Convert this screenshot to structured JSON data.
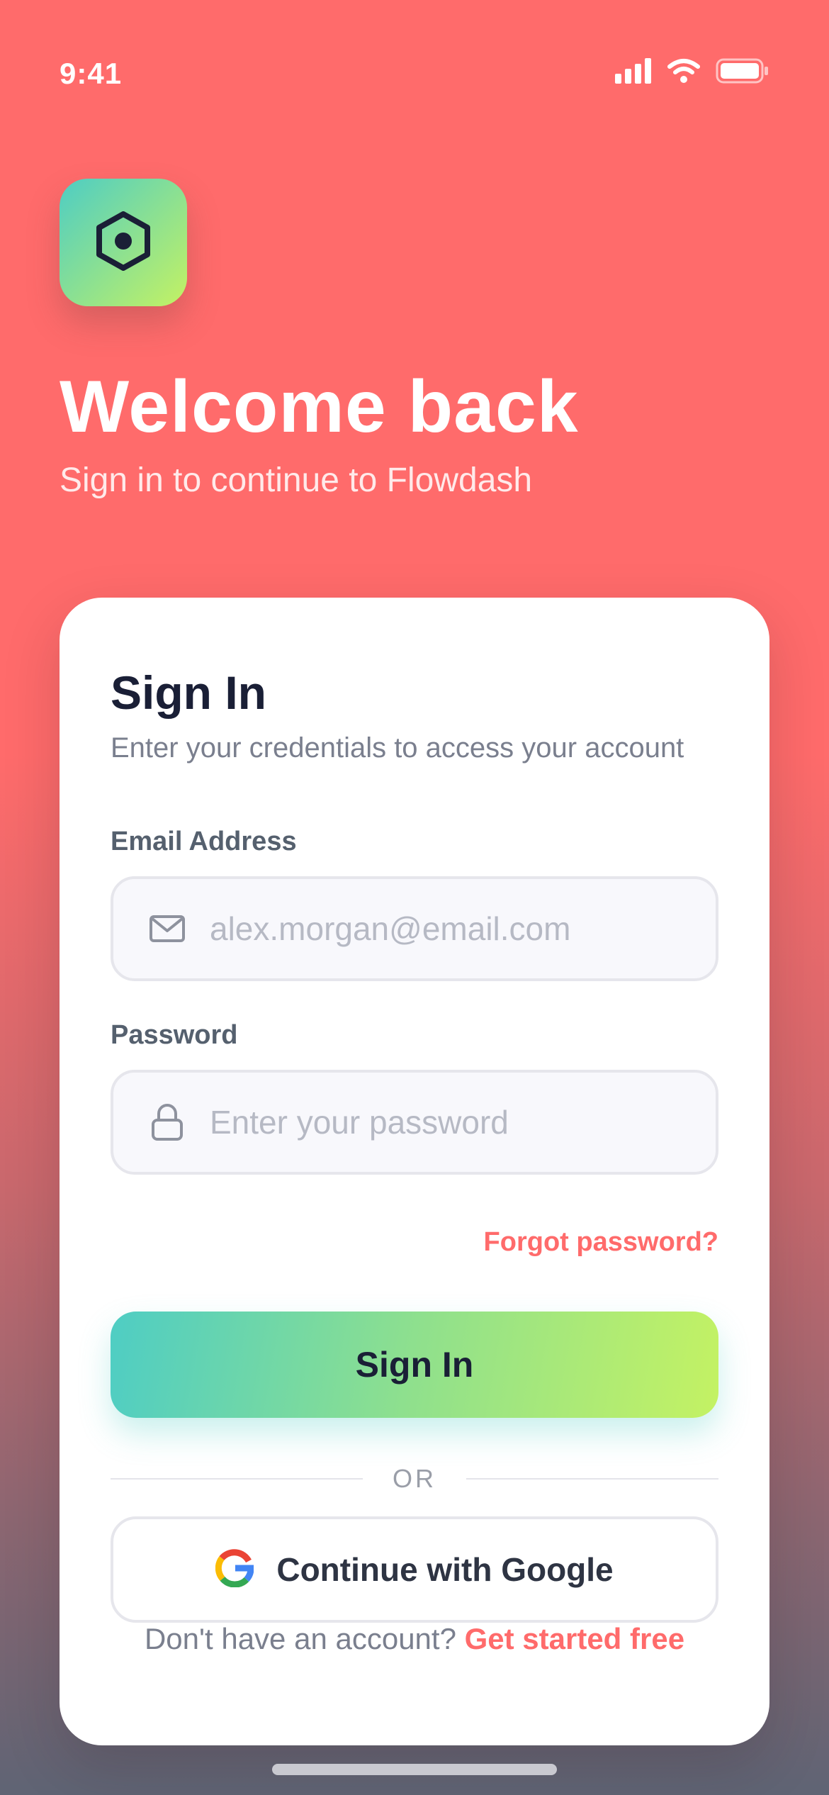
{
  "status_bar": {
    "time": "9:41",
    "icons": [
      "cellular-signal-icon",
      "wifi-icon",
      "battery-icon"
    ]
  },
  "header": {
    "logo_icon": "hexagon-logo-icon",
    "title": "Welcome back",
    "subtitle": "Sign in to continue to Flowdash"
  },
  "form": {
    "title": "Sign In",
    "subtitle": "Enter your credentials to access your account",
    "email": {
      "label": "Email Address",
      "placeholder": "alex.morgan@email.com",
      "value": "",
      "icon": "mail-icon"
    },
    "password": {
      "label": "Password",
      "placeholder": "Enter your password",
      "value": "",
      "icon": "lock-icon"
    },
    "forgot_label": "Forgot password?",
    "submit_label": "Sign In",
    "divider_label": "OR",
    "google_label": "Continue with Google",
    "signup_prompt": "Don't have an account?",
    "signup_link": "Get started free"
  },
  "colors": {
    "accent": "#FF6B6B",
    "gradient_start": "#4ECDC4",
    "gradient_end": "#C4F263",
    "text_dark": "#1A1F36",
    "text_muted": "#7A7F8E"
  }
}
